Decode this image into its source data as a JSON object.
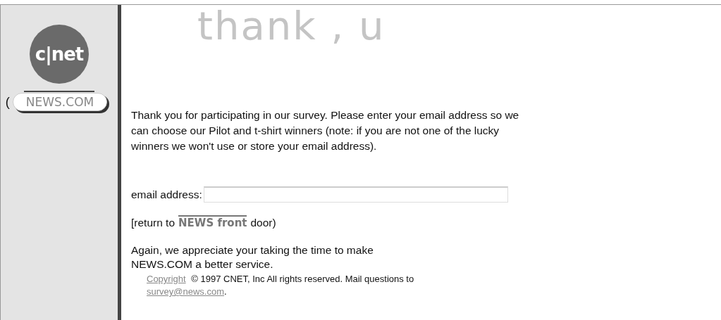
{
  "sidebar": {
    "logo_text": "c|net",
    "bracket": "(",
    "site_label": "NEWS.COM"
  },
  "heading": "thank , u",
  "intro": "Thank you for participating in our survey. Please enter your email address so we can choose our Pilot and t-shirt winners (note: if you are not one of the lucky winners we won't use or store your email address).",
  "email_field": {
    "label": "email address:"
  },
  "return_line": {
    "before": "[return to",
    "link": "NEWS front",
    "after": "door)"
  },
  "closing_lines": [
    "Again, we appreciate your taking the time to make",
    "NEWS.COM a better service."
  ],
  "footer": {
    "copyright_link": "Copyright",
    "text": "© 1997 CNET, Inc All rights reserved. Mail questions to",
    "email_link": "survey@news.com",
    "end": "."
  }
}
